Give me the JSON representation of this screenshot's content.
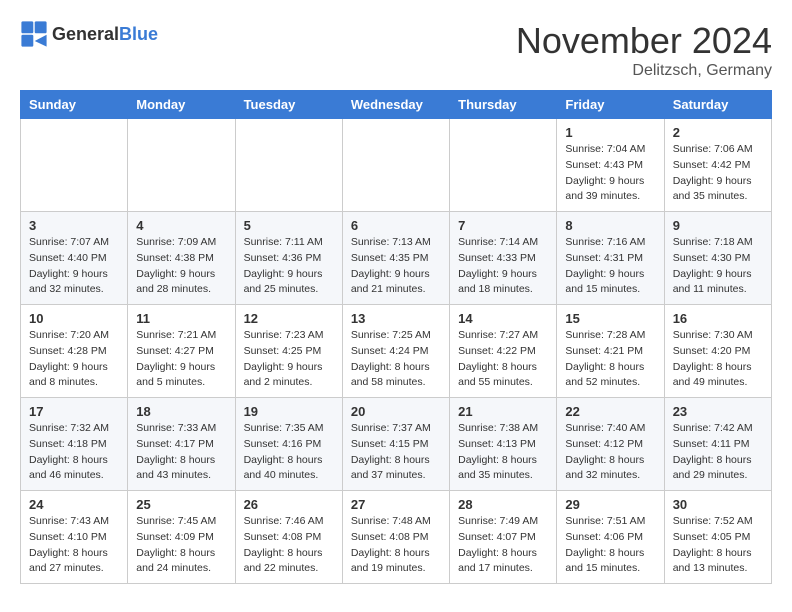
{
  "logo": {
    "text_general": "General",
    "text_blue": "Blue"
  },
  "header": {
    "month_year": "November 2024",
    "location": "Delitzsch, Germany"
  },
  "weekdays": [
    "Sunday",
    "Monday",
    "Tuesday",
    "Wednesday",
    "Thursday",
    "Friday",
    "Saturday"
  ],
  "weeks": [
    [
      {
        "day": "",
        "info": ""
      },
      {
        "day": "",
        "info": ""
      },
      {
        "day": "",
        "info": ""
      },
      {
        "day": "",
        "info": ""
      },
      {
        "day": "",
        "info": ""
      },
      {
        "day": "1",
        "info": "Sunrise: 7:04 AM\nSunset: 4:43 PM\nDaylight: 9 hours\nand 39 minutes."
      },
      {
        "day": "2",
        "info": "Sunrise: 7:06 AM\nSunset: 4:42 PM\nDaylight: 9 hours\nand 35 minutes."
      }
    ],
    [
      {
        "day": "3",
        "info": "Sunrise: 7:07 AM\nSunset: 4:40 PM\nDaylight: 9 hours\nand 32 minutes."
      },
      {
        "day": "4",
        "info": "Sunrise: 7:09 AM\nSunset: 4:38 PM\nDaylight: 9 hours\nand 28 minutes."
      },
      {
        "day": "5",
        "info": "Sunrise: 7:11 AM\nSunset: 4:36 PM\nDaylight: 9 hours\nand 25 minutes."
      },
      {
        "day": "6",
        "info": "Sunrise: 7:13 AM\nSunset: 4:35 PM\nDaylight: 9 hours\nand 21 minutes."
      },
      {
        "day": "7",
        "info": "Sunrise: 7:14 AM\nSunset: 4:33 PM\nDaylight: 9 hours\nand 18 minutes."
      },
      {
        "day": "8",
        "info": "Sunrise: 7:16 AM\nSunset: 4:31 PM\nDaylight: 9 hours\nand 15 minutes."
      },
      {
        "day": "9",
        "info": "Sunrise: 7:18 AM\nSunset: 4:30 PM\nDaylight: 9 hours\nand 11 minutes."
      }
    ],
    [
      {
        "day": "10",
        "info": "Sunrise: 7:20 AM\nSunset: 4:28 PM\nDaylight: 9 hours\nand 8 minutes."
      },
      {
        "day": "11",
        "info": "Sunrise: 7:21 AM\nSunset: 4:27 PM\nDaylight: 9 hours\nand 5 minutes."
      },
      {
        "day": "12",
        "info": "Sunrise: 7:23 AM\nSunset: 4:25 PM\nDaylight: 9 hours\nand 2 minutes."
      },
      {
        "day": "13",
        "info": "Sunrise: 7:25 AM\nSunset: 4:24 PM\nDaylight: 8 hours\nand 58 minutes."
      },
      {
        "day": "14",
        "info": "Sunrise: 7:27 AM\nSunset: 4:22 PM\nDaylight: 8 hours\nand 55 minutes."
      },
      {
        "day": "15",
        "info": "Sunrise: 7:28 AM\nSunset: 4:21 PM\nDaylight: 8 hours\nand 52 minutes."
      },
      {
        "day": "16",
        "info": "Sunrise: 7:30 AM\nSunset: 4:20 PM\nDaylight: 8 hours\nand 49 minutes."
      }
    ],
    [
      {
        "day": "17",
        "info": "Sunrise: 7:32 AM\nSunset: 4:18 PM\nDaylight: 8 hours\nand 46 minutes."
      },
      {
        "day": "18",
        "info": "Sunrise: 7:33 AM\nSunset: 4:17 PM\nDaylight: 8 hours\nand 43 minutes."
      },
      {
        "day": "19",
        "info": "Sunrise: 7:35 AM\nSunset: 4:16 PM\nDaylight: 8 hours\nand 40 minutes."
      },
      {
        "day": "20",
        "info": "Sunrise: 7:37 AM\nSunset: 4:15 PM\nDaylight: 8 hours\nand 37 minutes."
      },
      {
        "day": "21",
        "info": "Sunrise: 7:38 AM\nSunset: 4:13 PM\nDaylight: 8 hours\nand 35 minutes."
      },
      {
        "day": "22",
        "info": "Sunrise: 7:40 AM\nSunset: 4:12 PM\nDaylight: 8 hours\nand 32 minutes."
      },
      {
        "day": "23",
        "info": "Sunrise: 7:42 AM\nSunset: 4:11 PM\nDaylight: 8 hours\nand 29 minutes."
      }
    ],
    [
      {
        "day": "24",
        "info": "Sunrise: 7:43 AM\nSunset: 4:10 PM\nDaylight: 8 hours\nand 27 minutes."
      },
      {
        "day": "25",
        "info": "Sunrise: 7:45 AM\nSunset: 4:09 PM\nDaylight: 8 hours\nand 24 minutes."
      },
      {
        "day": "26",
        "info": "Sunrise: 7:46 AM\nSunset: 4:08 PM\nDaylight: 8 hours\nand 22 minutes."
      },
      {
        "day": "27",
        "info": "Sunrise: 7:48 AM\nSunset: 4:08 PM\nDaylight: 8 hours\nand 19 minutes."
      },
      {
        "day": "28",
        "info": "Sunrise: 7:49 AM\nSunset: 4:07 PM\nDaylight: 8 hours\nand 17 minutes."
      },
      {
        "day": "29",
        "info": "Sunrise: 7:51 AM\nSunset: 4:06 PM\nDaylight: 8 hours\nand 15 minutes."
      },
      {
        "day": "30",
        "info": "Sunrise: 7:52 AM\nSunset: 4:05 PM\nDaylight: 8 hours\nand 13 minutes."
      }
    ]
  ]
}
